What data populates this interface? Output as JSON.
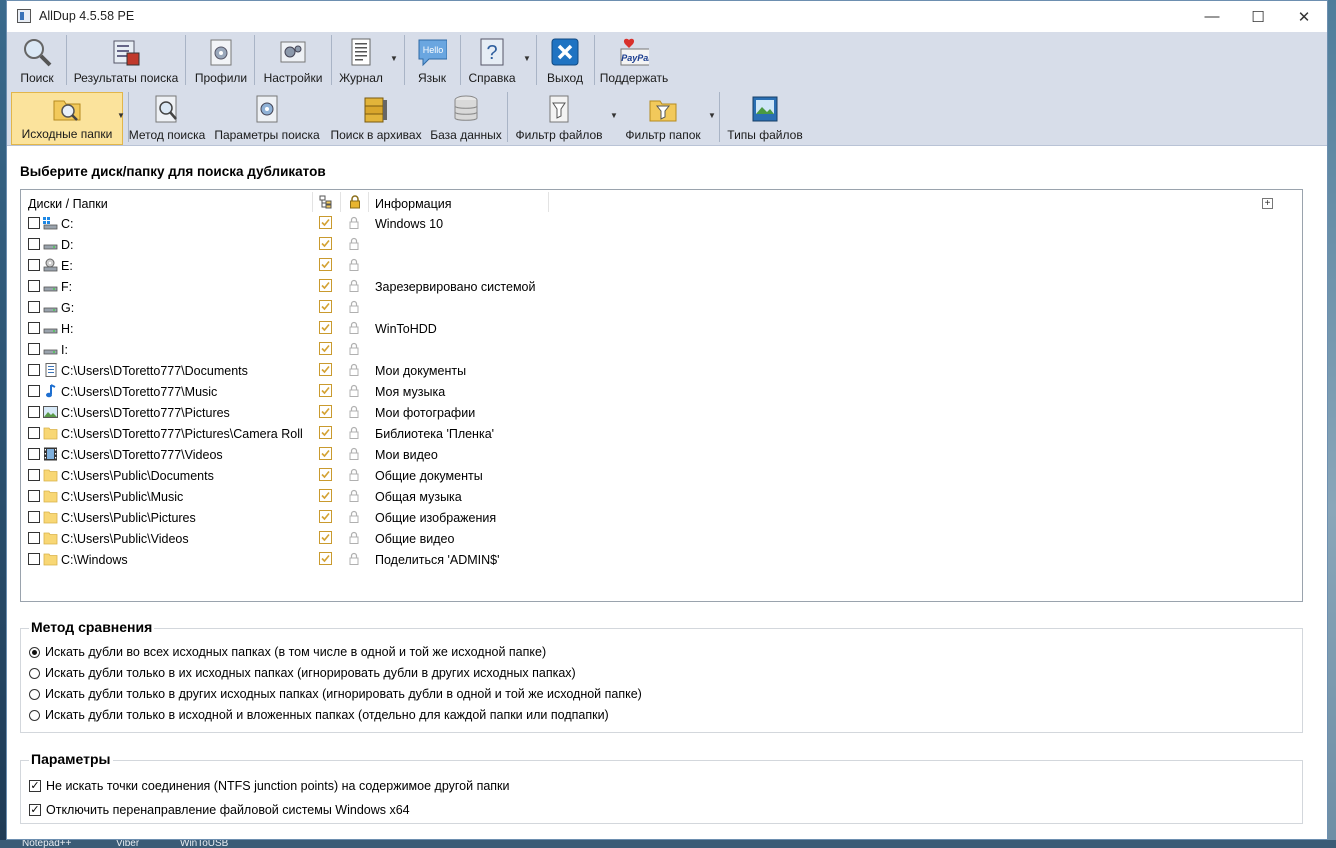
{
  "window": {
    "title": "AllDup 4.5.58 PE"
  },
  "toolbar1": [
    {
      "id": "search",
      "label": "Поиск",
      "icon": "magnifier-icon"
    },
    {
      "id": "results",
      "label": "Результаты поиска",
      "icon": "results-icon"
    },
    {
      "id": "profiles",
      "label": "Профили",
      "icon": "profiles-icon"
    },
    {
      "id": "settings",
      "label": "Настройки",
      "icon": "settings-icon"
    },
    {
      "id": "log",
      "label": "Журнал",
      "icon": "log-icon"
    },
    {
      "id": "language",
      "label": "Язык",
      "icon": "hello-icon",
      "badge": "Hello"
    },
    {
      "id": "help",
      "label": "Справка",
      "icon": "help-icon"
    },
    {
      "id": "exit",
      "label": "Выход",
      "icon": "exit-icon"
    },
    {
      "id": "donate",
      "label": "Поддержать",
      "icon": "paypal-icon",
      "badge": "PayPal"
    }
  ],
  "toolbar2": [
    {
      "id": "source",
      "label": "Исходные папки",
      "icon": "source-folders-icon",
      "active": true
    },
    {
      "id": "method",
      "label": "Метод поиска",
      "icon": "search-method-icon"
    },
    {
      "id": "params",
      "label": "Параметры поиска",
      "icon": "search-params-icon"
    },
    {
      "id": "archives",
      "label": "Поиск в архивах",
      "icon": "archive-icon"
    },
    {
      "id": "db",
      "label": "База данных",
      "icon": "database-icon"
    },
    {
      "id": "filefilter",
      "label": "Фильтр файлов",
      "icon": "file-filter-icon"
    },
    {
      "id": "folderfilter",
      "label": "Фильтр папок",
      "icon": "folder-filter-icon"
    },
    {
      "id": "filetypes",
      "label": "Типы файлов",
      "icon": "file-types-icon"
    }
  ],
  "section_title": "Выберите диск/папку для поиска дубликатов",
  "list": {
    "headers": {
      "name": "Диски / Папки",
      "info": "Информация"
    },
    "rows": [
      {
        "path": "C:",
        "info": "Windows 10",
        "icon": "windows-drive-icon"
      },
      {
        "path": "D:",
        "info": "",
        "icon": "drive-icon"
      },
      {
        "path": "E:",
        "info": "",
        "icon": "optical-drive-icon"
      },
      {
        "path": "F:",
        "info": "Зарезервировано системой",
        "icon": "drive-icon"
      },
      {
        "path": "G:",
        "info": "",
        "icon": "drive-icon"
      },
      {
        "path": "H:",
        "info": "WinToHDD",
        "icon": "drive-icon"
      },
      {
        "path": "I:",
        "info": "",
        "icon": "drive-icon"
      },
      {
        "path": "C:\\Users\\DToretto777\\Documents",
        "info": "Мои документы",
        "icon": "documents-icon"
      },
      {
        "path": "C:\\Users\\DToretto777\\Music",
        "info": "Моя музыка",
        "icon": "music-icon"
      },
      {
        "path": "C:\\Users\\DToretto777\\Pictures",
        "info": "Мои фотографии",
        "icon": "pictures-icon"
      },
      {
        "path": "C:\\Users\\DToretto777\\Pictures\\Camera Roll",
        "info": "Библиотека 'Пленка'",
        "icon": "folder-icon"
      },
      {
        "path": "C:\\Users\\DToretto777\\Videos",
        "info": "Мои видео",
        "icon": "video-icon"
      },
      {
        "path": "C:\\Users\\Public\\Documents",
        "info": "Общие документы",
        "icon": "folder-icon"
      },
      {
        "path": "C:\\Users\\Public\\Music",
        "info": "Общая музыка",
        "icon": "folder-icon"
      },
      {
        "path": "C:\\Users\\Public\\Pictures",
        "info": "Общие изображения",
        "icon": "folder-icon"
      },
      {
        "path": "C:\\Users\\Public\\Videos",
        "info": "Общие видео",
        "icon": "folder-icon"
      },
      {
        "path": "C:\\Windows",
        "info": "Поделиться 'ADMIN$'",
        "icon": "folder-icon"
      }
    ]
  },
  "compare": {
    "title": "Метод сравнения",
    "selected": 0,
    "options": [
      "Искать дубли во всех исходных папках (в том числе в одной и той же исходной папке)",
      "Искать дубли только в их исходных папках (игнорировать дубли в других исходных папках)",
      "Искать дубли только в других исходных папках (игнорировать дубли в одной и той же исходной папке)",
      "Искать дубли только в исходной и вложенных папках (отдельно для каждой папки или подпапки)"
    ]
  },
  "params": {
    "title": "Параметры",
    "options": [
      {
        "label": "Не искать точки соединения (NTFS junction points) на содержимое другой папки",
        "checked": true
      },
      {
        "label": "Отключить перенаправление файловой системы Windows x64",
        "checked": true
      }
    ]
  },
  "taskbar": [
    "Notepad++",
    "Viber",
    "WinToUSB"
  ],
  "colors": {
    "toolbar_bg": "#d7dde9",
    "active_bg": "#fbe39c",
    "folder": "#f8d775",
    "accent": "#3a73b8"
  }
}
